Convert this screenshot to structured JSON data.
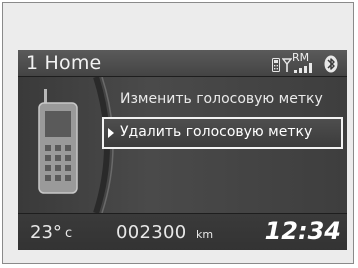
{
  "header": {
    "title": "1 Home",
    "roaming_label": "RM"
  },
  "menu": {
    "items": [
      {
        "label": "Изменить голосовую метку",
        "selected": false
      },
      {
        "label": "Удалить голосовую метку",
        "selected": true
      }
    ]
  },
  "footer": {
    "temperature": "23°",
    "temperature_unit": "c",
    "odometer": "002300",
    "odometer_unit": "km",
    "clock": "12:34"
  },
  "icons": {
    "phone_status": "phone-status-icon",
    "antenna": "antenna-icon",
    "signal": "signal-strength-icon",
    "bluetooth": "bluetooth-icon",
    "handset": "mobile-phone-icon",
    "selection": "selection-arrow-icon"
  },
  "colors": {
    "screen_background": "#3c3c3c",
    "text": "#f2f2f2",
    "selection_border": "#f2f2f2",
    "frame_background": "#ececec"
  }
}
